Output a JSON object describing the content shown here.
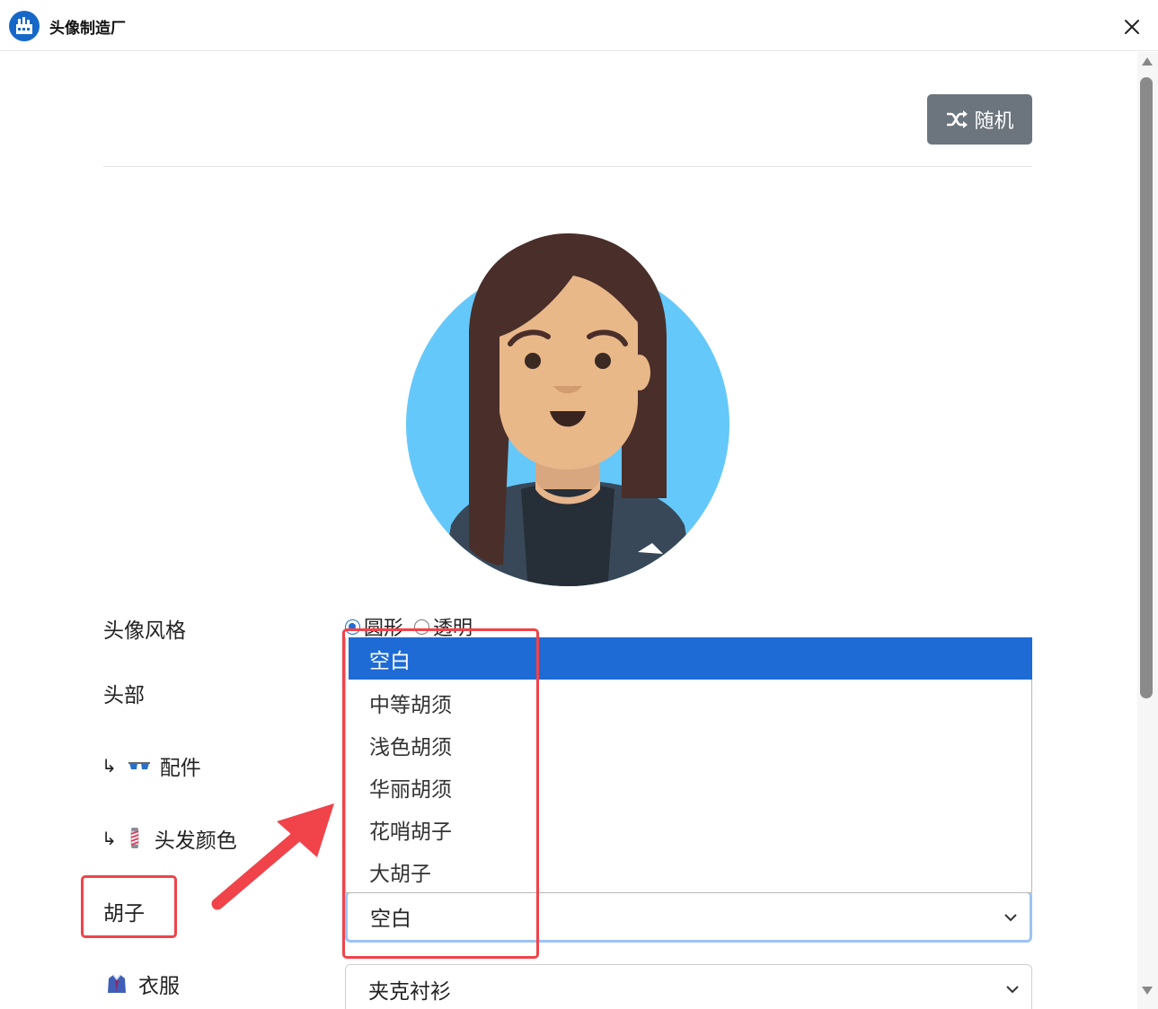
{
  "window": {
    "title": "头像制造厂"
  },
  "toolbar": {
    "random_label": "随机"
  },
  "form": {
    "style_label": "头像风格",
    "style_options": [
      "圆形",
      "透明"
    ],
    "style_selected": "圆形",
    "head_label": "头部",
    "accessory_label": "配件",
    "hair_color_label": "头发颜色",
    "beard_label": "胡子",
    "beard_value": "空白",
    "beard_options": [
      "空白",
      "中等胡须",
      "浅色胡须",
      "华丽胡须",
      "花哨胡子",
      "大胡子"
    ],
    "clothes_label": "衣服",
    "clothes_value": "夹克衬衫"
  },
  "colors": {
    "accent": "#1e6bd6",
    "button_gray": "#6c757d",
    "annotation_red": "#f0434a",
    "avatar_bg": "#65c8fa"
  },
  "icons": [
    "factory-icon",
    "close-icon",
    "shuffle-icon",
    "sunglasses-icon",
    "barber-pole-icon",
    "coat-icon",
    "chevron-down-icon"
  ]
}
